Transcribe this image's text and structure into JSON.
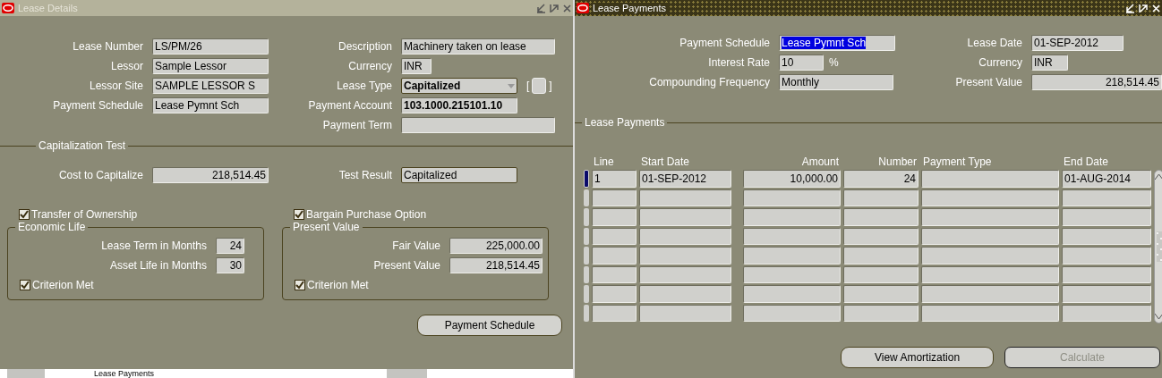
{
  "lease_details": {
    "title": "Lease Details",
    "fields_left": [
      {
        "label": "Lease Number",
        "value": "LS/PM/26",
        "kind": "text",
        "highlighted": false
      },
      {
        "label": "Lessor",
        "value": "Sample Lessor",
        "kind": "text",
        "highlighted": false
      },
      {
        "label": "Lessor Site",
        "value": "SAMPLE LESSOR S",
        "kind": "text",
        "highlighted": false
      },
      {
        "label": "Payment Schedule",
        "value": "Lease Pymnt Sch",
        "kind": "text",
        "highlighted": false
      }
    ],
    "fields_right": [
      {
        "label": "Description",
        "value": "Machinery taken on lease",
        "kind": "wide",
        "highlighted": false
      },
      {
        "label": "Currency",
        "value": "INR",
        "kind": "short",
        "highlighted": false
      },
      {
        "label": "Lease Type",
        "value": "Capitalized",
        "kind": "select",
        "highlighted": false
      },
      {
        "label": "Payment Account",
        "value": "103.1000.215101.10",
        "kind": "account",
        "highlighted": false
      },
      {
        "label": "Payment Term",
        "kind": "wide",
        "highlighted": false
      }
    ],
    "flex_field": {
      "open": "[",
      "close": "]"
    },
    "capitalization_test": {
      "title": "Capitalization Test",
      "cost": {
        "label": "Cost to Capitalize",
        "value": "218,514.45"
      },
      "result": {
        "label": "Test Result",
        "value": "Capitalized"
      },
      "groups": [
        {
          "option": {
            "label": "Transfer of Ownership",
            "checked": true
          },
          "title": "Economic Life",
          "fields": [
            {
              "label": "Lease Term in Months",
              "value": "24"
            },
            {
              "label": "Asset Life in Months",
              "value": "30"
            }
          ],
          "criterion": {
            "label": "Criterion Met",
            "checked": true
          },
          "kind": "months"
        },
        {
          "option": {
            "label": "Bargain Purchase Option",
            "checked": true
          },
          "title": "Present Value",
          "fields": [
            {
              "label": "Fair Value",
              "value": "225,000.00"
            },
            {
              "label": "Present Value",
              "value": "218,514.45"
            }
          ],
          "criterion": {
            "label": "Criterion Met",
            "checked": true
          },
          "kind": "amount"
        }
      ]
    },
    "button": "Payment Schedule",
    "background_tab": "Lease Payments"
  },
  "lease_payments": {
    "title": "Lease Payments",
    "fields_left": [
      {
        "label": "Payment Schedule",
        "value": "Lease Pymnt Sch",
        "kind": "text",
        "highlighted": true
      },
      {
        "label": "Interest Rate",
        "value": "10",
        "kind": "rate",
        "suffix": "%",
        "highlighted": false
      },
      {
        "label": "Compounding Frequency",
        "value": "Monthly",
        "kind": "wide",
        "highlighted": false
      }
    ],
    "fields_right": [
      {
        "label": "Lease Date",
        "value": "01-SEP-2012",
        "kind": "text",
        "highlighted": false
      },
      {
        "label": "Currency",
        "value": "INR",
        "kind": "short",
        "highlighted": false
      },
      {
        "label": "Present Value",
        "value": "218,514.45",
        "kind": "amount",
        "highlighted": false
      }
    ],
    "section_title": "Lease Payments",
    "table": {
      "columns": [
        {
          "label": "Line",
          "kind": "text"
        },
        {
          "label": "Start Date",
          "kind": "text"
        },
        {
          "label": "Amount",
          "kind": "number"
        },
        {
          "label": "Number",
          "kind": "number"
        },
        {
          "label": "Payment Type",
          "kind": "text"
        },
        {
          "label": "End Date",
          "kind": "text"
        }
      ],
      "rows": [
        {
          "selected": true,
          "line": "1",
          "start_date": "01-SEP-2012",
          "amount": "10,000.00",
          "number": "24",
          "end_date": "01-AUG-2014"
        }
      ]
    },
    "buttons": [
      {
        "label": "View Amortization",
        "disabled": false
      },
      {
        "label": "Calculate",
        "disabled": true
      }
    ]
  }
}
